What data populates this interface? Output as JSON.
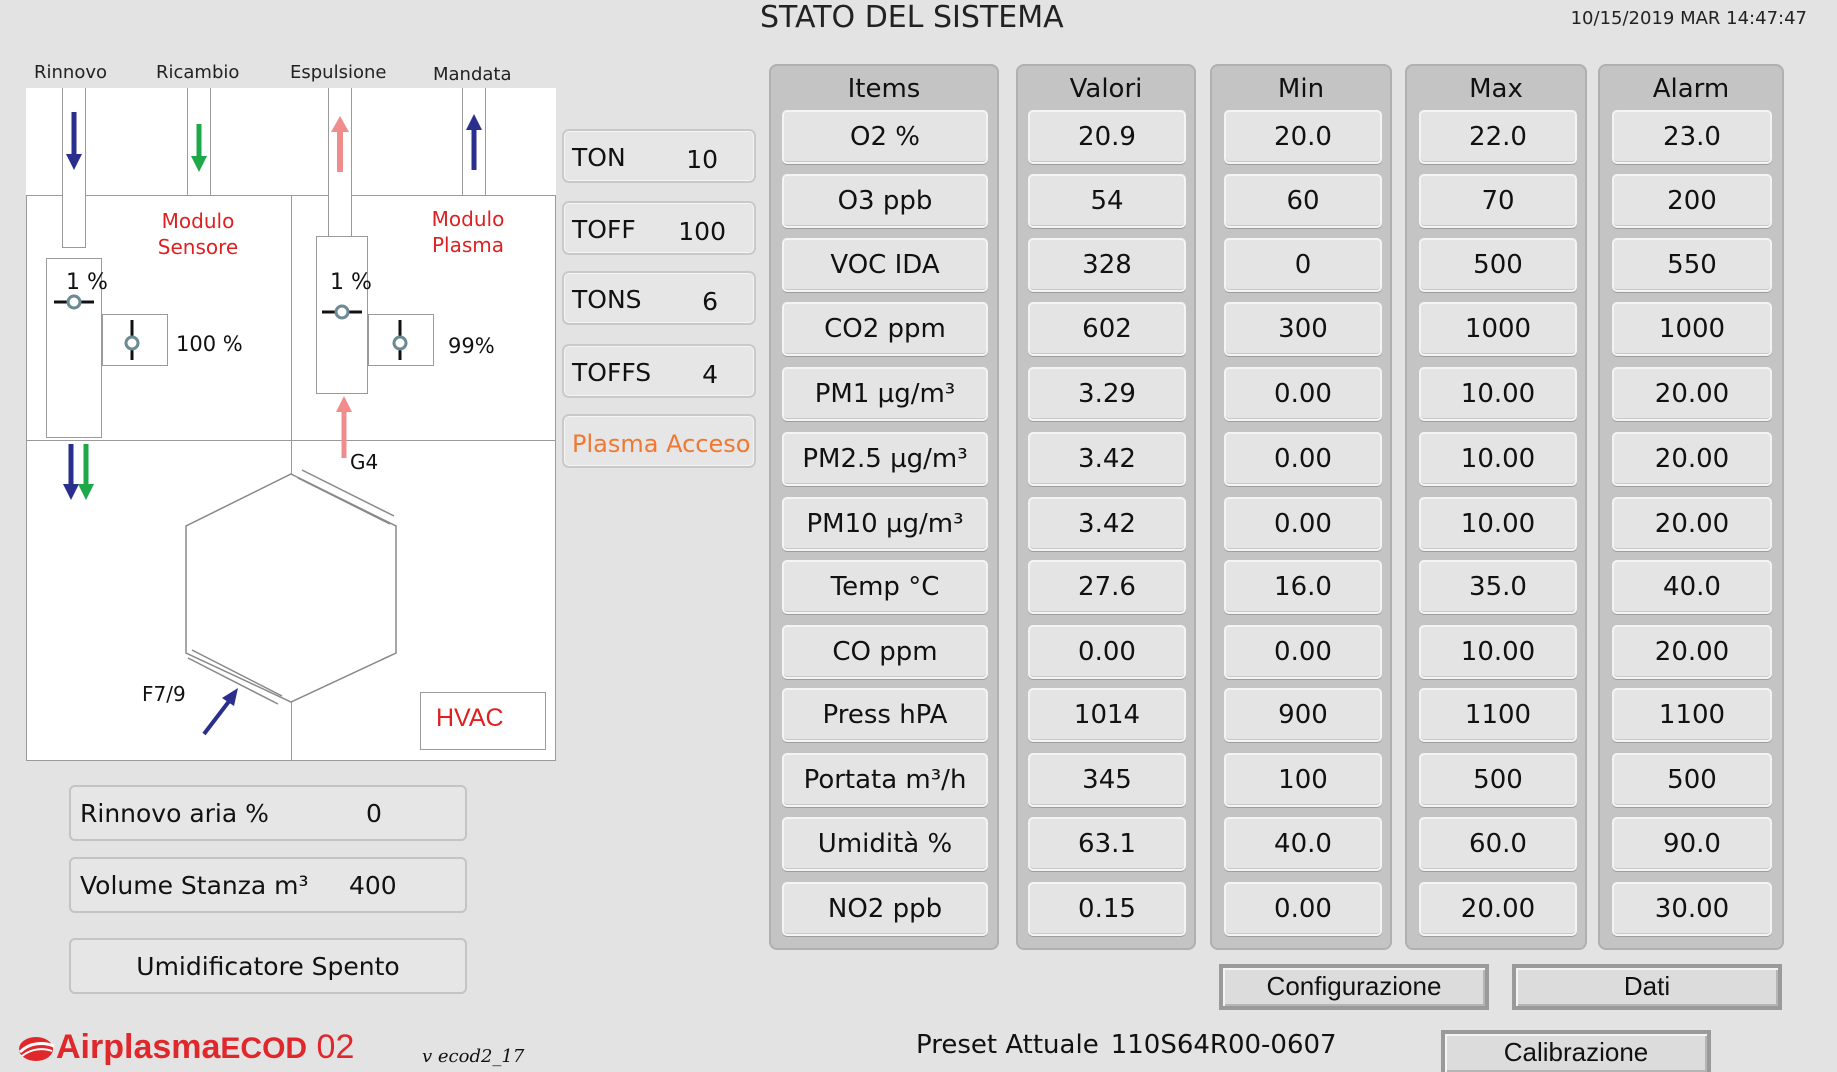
{
  "header": {
    "title": "STATO DEL SISTEMA",
    "datetime": "10/15/2019 MAR 14:47:47"
  },
  "diagram": {
    "columns": [
      "Rinnovo",
      "Ricambio",
      "Espulsione",
      "Mandata"
    ],
    "modulo_sensore": [
      "Modulo",
      "Sensore"
    ],
    "modulo_plasma": [
      "Modulo",
      "Plasma"
    ],
    "damper_left_pct": "1 %",
    "damper_left_side_pct": "100 %",
    "damper_right_pct": "1 %",
    "damper_right_side_pct": "99%",
    "filter_g4": "G4",
    "filter_f79": "F7/9",
    "hvac_label": "HVAC",
    "colors": {
      "blue_arrow": "#2a2e8c",
      "green_arrow": "#1ea84a",
      "pink_arrow": "#f08c8c",
      "red_text": "#e02020"
    }
  },
  "params": [
    {
      "key": "TON",
      "value": "10"
    },
    {
      "key": "TOFF",
      "value": "100"
    },
    {
      "key": "TONS",
      "value": "6"
    },
    {
      "key": "TOFFS",
      "value": "4"
    }
  ],
  "plasma_status": "Plasma Acceso",
  "left_panel": {
    "rinnovo_label": "Rinnovo aria %",
    "rinnovo_value": "0",
    "volume_label": "Volume Stanza m³",
    "volume_value": "400",
    "umidificatore": "Umidificatore Spento"
  },
  "table": {
    "headers": [
      "Items",
      "Valori",
      "Min",
      "Max",
      "Alarm"
    ],
    "rows": [
      [
        "O2 %",
        "20.9",
        "20.0",
        "22.0",
        "23.0"
      ],
      [
        "O3 ppb",
        "54",
        "60",
        "70",
        "200"
      ],
      [
        "VOC IDA",
        "328",
        "0",
        "500",
        "550"
      ],
      [
        "CO2 ppm",
        "602",
        "300",
        "1000",
        "1000"
      ],
      [
        "PM1 µg/m³",
        "3.29",
        "0.00",
        "10.00",
        "20.00"
      ],
      [
        "PM2.5 µg/m³",
        "3.42",
        "0.00",
        "10.00",
        "20.00"
      ],
      [
        "PM10  µg/m³",
        "3.42",
        "0.00",
        "10.00",
        "20.00"
      ],
      [
        "Temp °C",
        "27.6",
        "16.0",
        "35.0",
        "40.0"
      ],
      [
        "CO ppm",
        "0.00",
        "0.00",
        "10.00",
        "20.00"
      ],
      [
        "Press hPA",
        "1014",
        "900",
        "1100",
        "1100"
      ],
      [
        "Portata m³/h",
        "345",
        "100",
        "500",
        "500"
      ],
      [
        "Umidità %",
        "63.1",
        "40.0",
        "60.0",
        "90.0"
      ],
      [
        "NO2 ppb",
        "0.15",
        "0.00",
        "20.00",
        "30.00"
      ]
    ]
  },
  "buttons": {
    "configurazione": "Configurazione",
    "dati": "Dati",
    "calibrazione": "Calibrazione"
  },
  "preset": {
    "label": "Preset Attuale",
    "value": "110S64R00-0607"
  },
  "logo": {
    "brand": "Airplasma",
    "brand2": "ECOD",
    "model": "02",
    "version": "v ecod2_17"
  }
}
